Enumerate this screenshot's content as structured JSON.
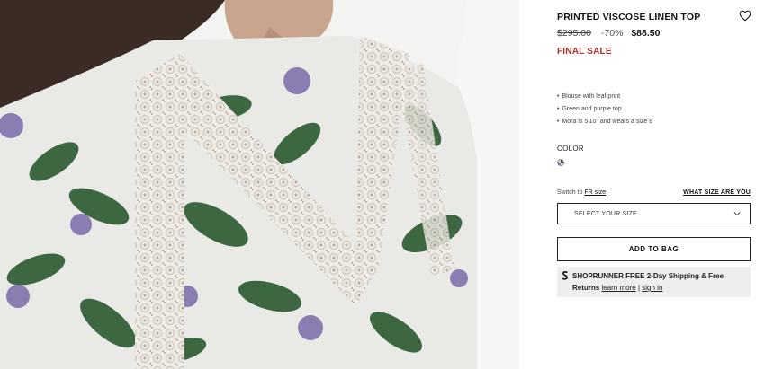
{
  "product": {
    "title": "PRINTED VISCOSE LINEN TOP",
    "price_original": "$295.00",
    "discount": "-70%",
    "price_sale": "$88.50",
    "sale_note": "FINAL SALE",
    "features": [
      "Blouse with leaf print",
      "Green and purple top",
      "Mora is 5'10\" and wears a size 8"
    ],
    "color_label": "COLOR",
    "swatch_icon": "multicolor-swatch-icon"
  },
  "size": {
    "switch_prefix": "Switch to",
    "switch_link": "FR size",
    "guide_link": "WHAT SIZE ARE YOU",
    "select_placeholder": "SELECT YOUR SIZE"
  },
  "cart": {
    "add_label": "ADD TO BAG"
  },
  "shoprunner": {
    "brand": "SHOPRUNNER",
    "offer": "FREE 2-Day Shipping & Free",
    "returns": "Returns",
    "learn_more": "learn more",
    "separator": "|",
    "sign_in": "sign in"
  },
  "colors": {
    "sale_red": "#b0302a",
    "leaf_green": "#2d5b33",
    "flower_purple": "#7a6aa8"
  }
}
